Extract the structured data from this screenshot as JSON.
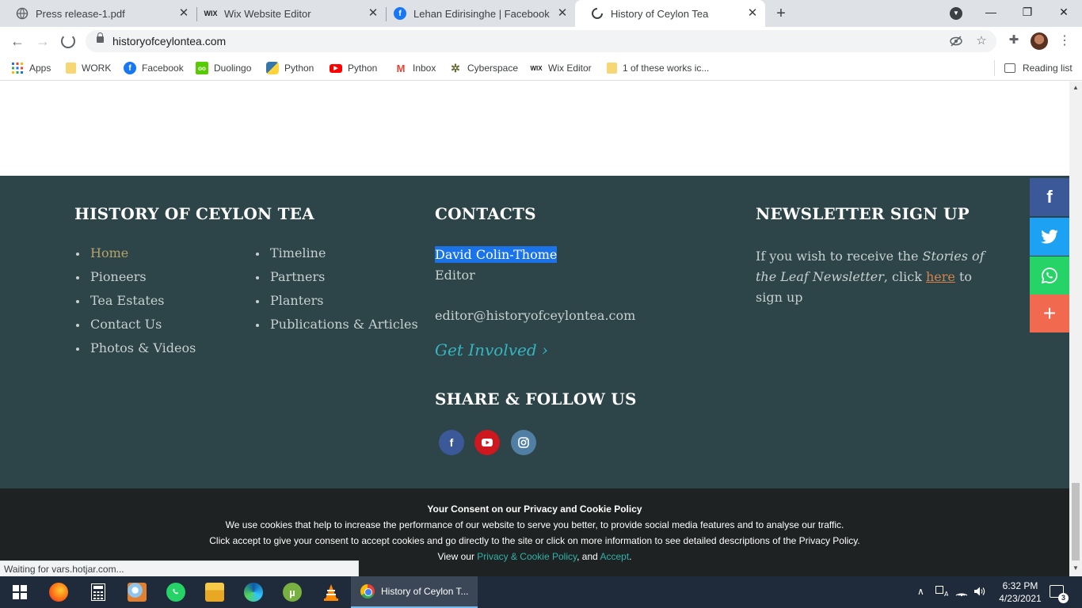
{
  "browser": {
    "tabs": [
      {
        "title": "Press release-1.pdf",
        "icon": "globe-icon",
        "close": "✕"
      },
      {
        "title": "Wix Website Editor",
        "icon": "wix-icon",
        "close": "✕"
      },
      {
        "title": "Lehan Edirisinghe | Facebook",
        "icon": "facebook-icon",
        "close": "✕"
      },
      {
        "title": "History of Ceylon Tea",
        "icon": "loading-icon",
        "close": "✕"
      }
    ],
    "new_tab": "+",
    "url": "historyofceylontea.com",
    "bookmarks": [
      {
        "label": "Apps",
        "icon": "apps-grid-icon"
      },
      {
        "label": "WORK",
        "icon": "folder-icon"
      },
      {
        "label": "Facebook",
        "icon": "facebook-icon"
      },
      {
        "label": "Duolingo",
        "icon": "duolingo-icon"
      },
      {
        "label": "Python",
        "icon": "python-icon"
      },
      {
        "label": "Python",
        "icon": "youtube-icon"
      },
      {
        "label": "Inbox",
        "icon": "gmail-icon"
      },
      {
        "label": "Cyberspace",
        "icon": "cyberspace-icon"
      },
      {
        "label": "Wix Editor",
        "icon": "wix-icon"
      },
      {
        "label": "1 of these works ic...",
        "icon": "folder-icon"
      }
    ],
    "reading_list": "Reading list",
    "status": "Waiting for vars.hotjar.com..."
  },
  "footer": {
    "col1": {
      "heading": "HISTORY OF CEYLON TEA",
      "links_left": [
        "Home",
        "Pioneers",
        "Tea Estates",
        "Contact Us",
        "Photos & Videos"
      ],
      "links_right": [
        "Timeline",
        "Partners",
        "Planters",
        "Publications & Articles"
      ]
    },
    "contacts": {
      "heading": "CONTACTS",
      "name": "David Colin-Thome",
      "role": "Editor",
      "email": "editor@historyofceylontea.com",
      "get_involved": "Get Involved ›"
    },
    "share": {
      "heading": "SHARE & FOLLOW US",
      "icons": [
        "facebook-icon",
        "youtube-icon",
        "instagram-icon"
      ]
    },
    "newsletter": {
      "heading": "NEWSLETTER SIGN UP",
      "text_before": "If you wish to receive the ",
      "italic": "Stories of the Leaf Newsletter",
      "text_mid": ", click ",
      "link": "here",
      "text_after": " to sign up"
    }
  },
  "share_bar": [
    {
      "icon": "facebook-icon",
      "color": "#3b5998"
    },
    {
      "icon": "twitter-icon",
      "color": "#1da1f2"
    },
    {
      "icon": "whatsapp-icon",
      "color": "#25d366"
    },
    {
      "icon": "plus-icon",
      "color": "#f16a50"
    }
  ],
  "consent": {
    "title": "Your Consent on our Privacy and Cookie Policy",
    "line1": "We use cookies that help to increase the performance of our website to serve you better, to provide social media features and to analyse our traffic.",
    "line2": "Click accept to give your consent to accept cookies and go directly to the site or click on more information to see detailed descriptions of the Privacy Policy.",
    "line3_prefix": "View our ",
    "policy_link": "Privacy & Cookie Policy",
    "line3_mid": ", and ",
    "accept_link": "Accept",
    "line3_suffix": "."
  },
  "taskbar": {
    "active_window": "History of Ceylon T...",
    "time": "6:32 PM",
    "date": "4/23/2021",
    "notifications": "3",
    "apps": [
      "firefox-icon",
      "calculator-icon",
      "paint-icon",
      "whatsapp-icon",
      "file-explorer-icon",
      "edge-icon",
      "utorrent-icon",
      "vlc-icon"
    ]
  }
}
